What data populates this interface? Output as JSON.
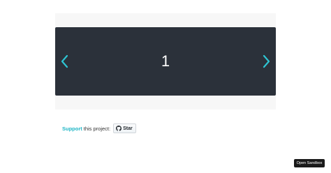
{
  "carousel": {
    "current_slide": "1",
    "prev_icon": "chevron-left-icon",
    "next_icon": "chevron-right-icon",
    "accent_color": "#2ec5d3",
    "background_color": "#2b313a"
  },
  "support": {
    "link_label": "Support",
    "text": "this project:",
    "star_label": "Star",
    "star_icon": "github-icon"
  },
  "sandbox": {
    "label": "Open Sandbox"
  }
}
